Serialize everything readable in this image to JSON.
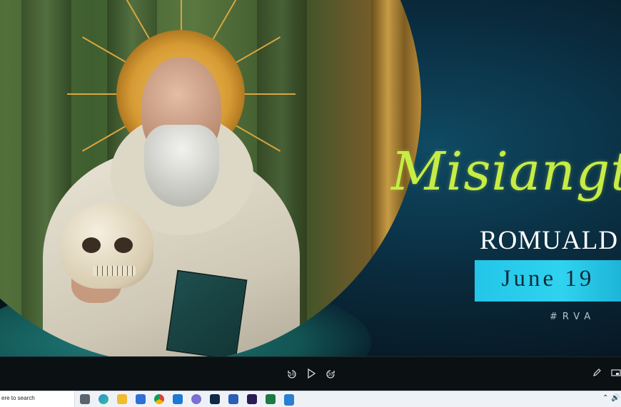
{
  "slide": {
    "script_title": "Misiangthou",
    "name": "ROMUALD",
    "date": "June 19",
    "hashtag": "#RVA"
  },
  "colors": {
    "script_title": "#c7ec45",
    "date_box": "#2fd2ef",
    "background": "#0a2c3f"
  },
  "player": {
    "icons": [
      "rewind-10-icon",
      "play-icon",
      "forward-30-icon",
      "pen-icon",
      "miniplayer-icon"
    ],
    "rewind_label": "10",
    "forward_label": "30"
  },
  "taskbar": {
    "search_placeholder": "ere to search",
    "apps": [
      "task-view-icon",
      "edge-icon",
      "file-explorer-icon",
      "store-icon",
      "chrome-icon",
      "mail-icon",
      "teams-icon",
      "photoshop-icon",
      "word-icon",
      "premiere-icon",
      "excel-icon",
      "media-player-icon"
    ]
  }
}
